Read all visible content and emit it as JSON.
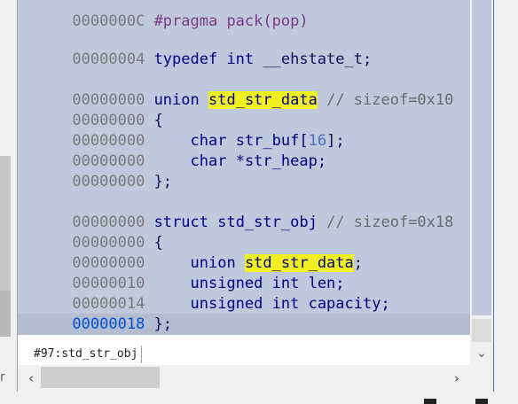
{
  "editor": {
    "lines": [
      {
        "addr": "0000000C",
        "text": "#pragma pack(pop)"
      },
      {
        "addr": "00000004",
        "kw": "typedef int",
        "rest": " __ehstate_t;"
      },
      {
        "addr": "00000000",
        "kw": "union",
        "name": "std_str_data",
        "comment": "// sizeof=0x10"
      },
      {
        "addr": "00000000",
        "text": "{"
      },
      {
        "addr": "00000000",
        "kw": "char",
        "name": "str_buf[",
        "num": "16",
        "tail": "];"
      },
      {
        "addr": "00000000",
        "kw": "char",
        "name": "*str_heap;"
      },
      {
        "addr": "00000000",
        "text": "};"
      },
      {
        "addr": "00000000",
        "kw": "struct",
        "name": "std_str_obj",
        "comment": "// sizeof=0x18"
      },
      {
        "addr": "00000000",
        "text": "{"
      },
      {
        "addr": "00000000",
        "kw": "union",
        "name": "std_str_data",
        "tail": ";"
      },
      {
        "addr": "00000010",
        "kw": "unsigned int",
        "name": "len;"
      },
      {
        "addr": "00000014",
        "kw": "unsigned int",
        "name": "capacity;"
      },
      {
        "addr": "00000018",
        "text": "};"
      }
    ]
  },
  "status": {
    "location": "#97:std_str_obj"
  },
  "icons": {
    "scroll_down": "chevron-down-icon",
    "scroll_left": "chevron-left-icon",
    "scroll_right": "chevron-right-icon"
  },
  "colors": {
    "code_bg": "#c0c8dc",
    "highlight": "#f0f020",
    "current_addr": "#0050d0",
    "keyword": "#00008b"
  }
}
